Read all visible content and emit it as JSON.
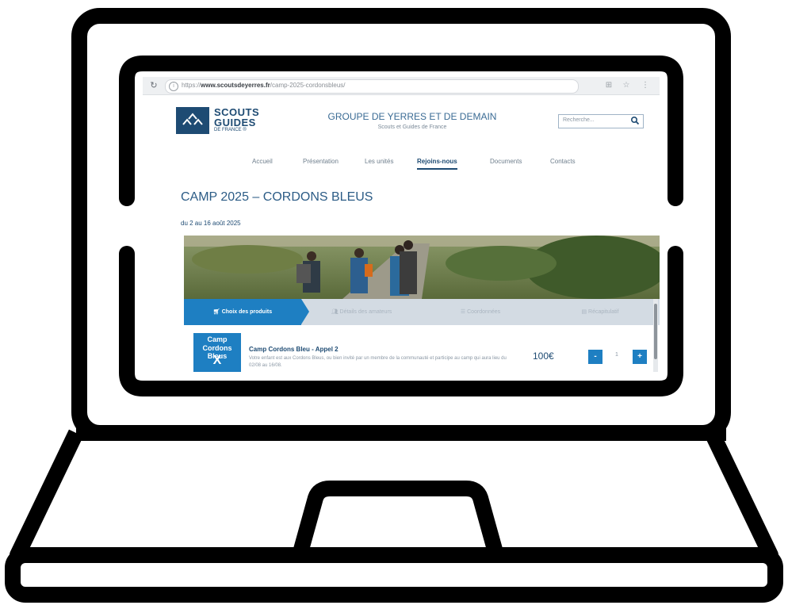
{
  "browser": {
    "url_prefix": "https://",
    "url_domain": "www.scoutsdeyerres.fr",
    "url_path": "/camp-2025-cordonsbleus/",
    "star_icon": "star-icon",
    "extensions_icon": "extensions-icon",
    "menu_icon": "more-menu-icon"
  },
  "site": {
    "logo_line1": "SCOUTS",
    "logo_line2": "GUIDES",
    "logo_line3": "DE FRANCE ®",
    "group_title": "GROUPE DE YERRES ET DE DEMAIN",
    "group_subtitle": "Scouts et Guides de France",
    "search_placeholder": "Recherche..."
  },
  "nav": {
    "items": [
      {
        "label": "Accueil"
      },
      {
        "label": "Présentation"
      },
      {
        "label": "Les unités"
      },
      {
        "label": "Rejoins-nous"
      },
      {
        "label": "Documents"
      },
      {
        "label": "Contacts"
      }
    ],
    "active_index": 3
  },
  "page": {
    "title": "CAMP 2025 – CORDONS BLEUS",
    "dates": "du 2 au 16 août 2025"
  },
  "steps": [
    {
      "label": "Choix des produits",
      "icon": "cart-icon",
      "active": true
    },
    {
      "label": "Détails des amateurs",
      "icon": "users-icon",
      "active": false
    },
    {
      "label": "Coordonnées",
      "icon": "contact-icon",
      "active": false
    },
    {
      "label": "Récapitulatif",
      "icon": "summary-icon",
      "active": false
    }
  ],
  "product": {
    "thumb_line1": "Camp",
    "thumb_line2": "Cordons Bleus",
    "thumb_mark": "X",
    "name": "Camp Cordons Bleu - Appel 2",
    "description": "Votre enfant est aux Cordons Bleus, ou bien invité par un membre de la communauté et participe au camp qui aura lieu du 02/08 au 16/08.",
    "price": "100€",
    "quantity": "1",
    "minus_label": "-",
    "plus_label": "+"
  },
  "colors": {
    "brand_navy": "#1e4b73",
    "accent_blue": "#1e7fc2",
    "laptop_outline": "#000000"
  }
}
